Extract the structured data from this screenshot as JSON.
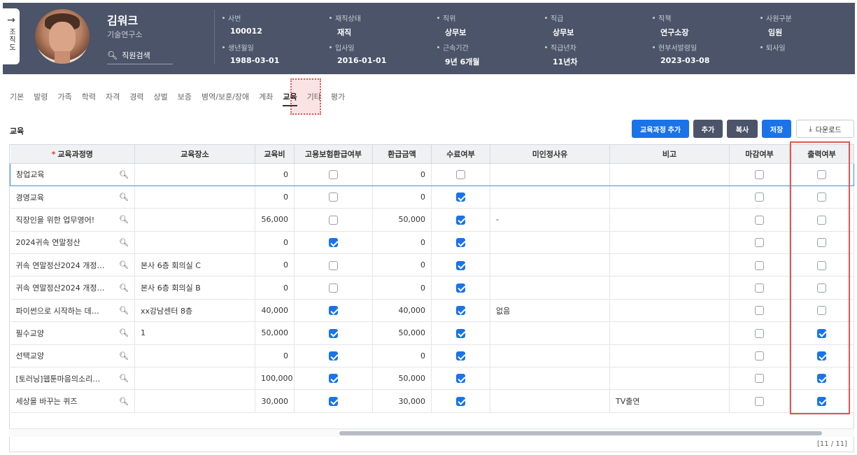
{
  "side_tab": {
    "label": "조직도"
  },
  "profile": {
    "name": "김워크",
    "dept": "기술연구소",
    "search_label": "직원검색"
  },
  "info_fields": [
    {
      "label": "사번",
      "value": "100012"
    },
    {
      "label": "재직상태",
      "value": "재직"
    },
    {
      "label": "직위",
      "value": "상무보"
    },
    {
      "label": "직급",
      "value": "상무보"
    },
    {
      "label": "직책",
      "value": "연구소장"
    },
    {
      "label": "사원구분",
      "value": "임원"
    },
    {
      "label": "생년월일",
      "value": "1988-03-01"
    },
    {
      "label": "입사일",
      "value": "2016-01-01"
    },
    {
      "label": "근속기간",
      "value": "9년 6개월"
    },
    {
      "label": "직급년차",
      "value": "11년차"
    },
    {
      "label": "현부서발령일",
      "value": "2023-03-08"
    },
    {
      "label": "퇴사일",
      "value": ""
    }
  ],
  "tabs": [
    "기본",
    "발령",
    "가족",
    "학력",
    "자격",
    "경력",
    "상벌",
    "보증",
    "병역/보훈/장애",
    "계좌",
    "교육",
    "기타",
    "평가"
  ],
  "active_tab": "교육",
  "section_title": "교육",
  "buttons": {
    "add_course": "교육과정 추가",
    "add": "추가",
    "copy": "복사",
    "save": "저장",
    "download": "다운로드"
  },
  "columns": [
    "교육과정명",
    "교육장소",
    "교육비",
    "고용보험환급여부",
    "환급금액",
    "수료여부",
    "미인정사유",
    "비고",
    "마감여부",
    "출력여부"
  ],
  "rows": [
    {
      "course": "창업교육",
      "place": "",
      "fee": "0",
      "refund": false,
      "refund_amt": "0",
      "completed": false,
      "reason": "",
      "note": "",
      "closed": false,
      "printed": false
    },
    {
      "course": "경영교육",
      "place": "",
      "fee": "0",
      "refund": false,
      "refund_amt": "0",
      "completed": true,
      "reason": "",
      "note": "",
      "closed": false,
      "printed": false
    },
    {
      "course": "직장인을 위한 업무영어!",
      "place": "",
      "fee": "56,000",
      "refund": false,
      "refund_amt": "50,000",
      "completed": true,
      "reason": "-",
      "note": "",
      "closed": false,
      "printed": false
    },
    {
      "course": "2024귀속 연말정산",
      "place": "",
      "fee": "0",
      "refund": true,
      "refund_amt": "0",
      "completed": true,
      "reason": "",
      "note": "",
      "closed": false,
      "printed": false
    },
    {
      "course": "귀속 연말정산2024 개정…",
      "place": "본사 6층 회의실 C",
      "fee": "0",
      "refund": false,
      "refund_amt": "0",
      "completed": true,
      "reason": "",
      "note": "",
      "closed": false,
      "printed": false
    },
    {
      "course": "귀속 연말정산2024 개정…",
      "place": "본사 6층 회의실 B",
      "fee": "0",
      "refund": false,
      "refund_amt": "0",
      "completed": true,
      "reason": "",
      "note": "",
      "closed": false,
      "printed": false
    },
    {
      "course": "파이썬으로 시작하는 데…",
      "place": "xx강남센터 8층",
      "fee": "40,000",
      "refund": true,
      "refund_amt": "40,000",
      "completed": true,
      "reason": "없음",
      "note": "",
      "closed": false,
      "printed": false
    },
    {
      "course": "필수교양",
      "place": "1",
      "fee": "50,000",
      "refund": true,
      "refund_amt": "50,000",
      "completed": true,
      "reason": "",
      "note": "",
      "closed": false,
      "printed": true
    },
    {
      "course": "선택교양",
      "place": "",
      "fee": "0",
      "refund": true,
      "refund_amt": "0",
      "completed": true,
      "reason": "",
      "note": "",
      "closed": false,
      "printed": true
    },
    {
      "course": "[토러닝]웹툰마음의소리…",
      "place": "",
      "fee": "100,000",
      "refund": true,
      "refund_amt": "50,000",
      "completed": true,
      "reason": "",
      "note": "",
      "closed": false,
      "printed": true
    },
    {
      "course": "세상을 바꾸는 퀴즈",
      "place": "",
      "fee": "30,000",
      "refund": true,
      "refund_amt": "30,000",
      "completed": true,
      "reason": "",
      "note": "TV출연",
      "closed": false,
      "printed": true
    }
  ],
  "pager": "[11 / 11]",
  "colors": {
    "header_bg": "#4b5468",
    "accent": "#1a73e8",
    "highlight": "#e05555"
  }
}
